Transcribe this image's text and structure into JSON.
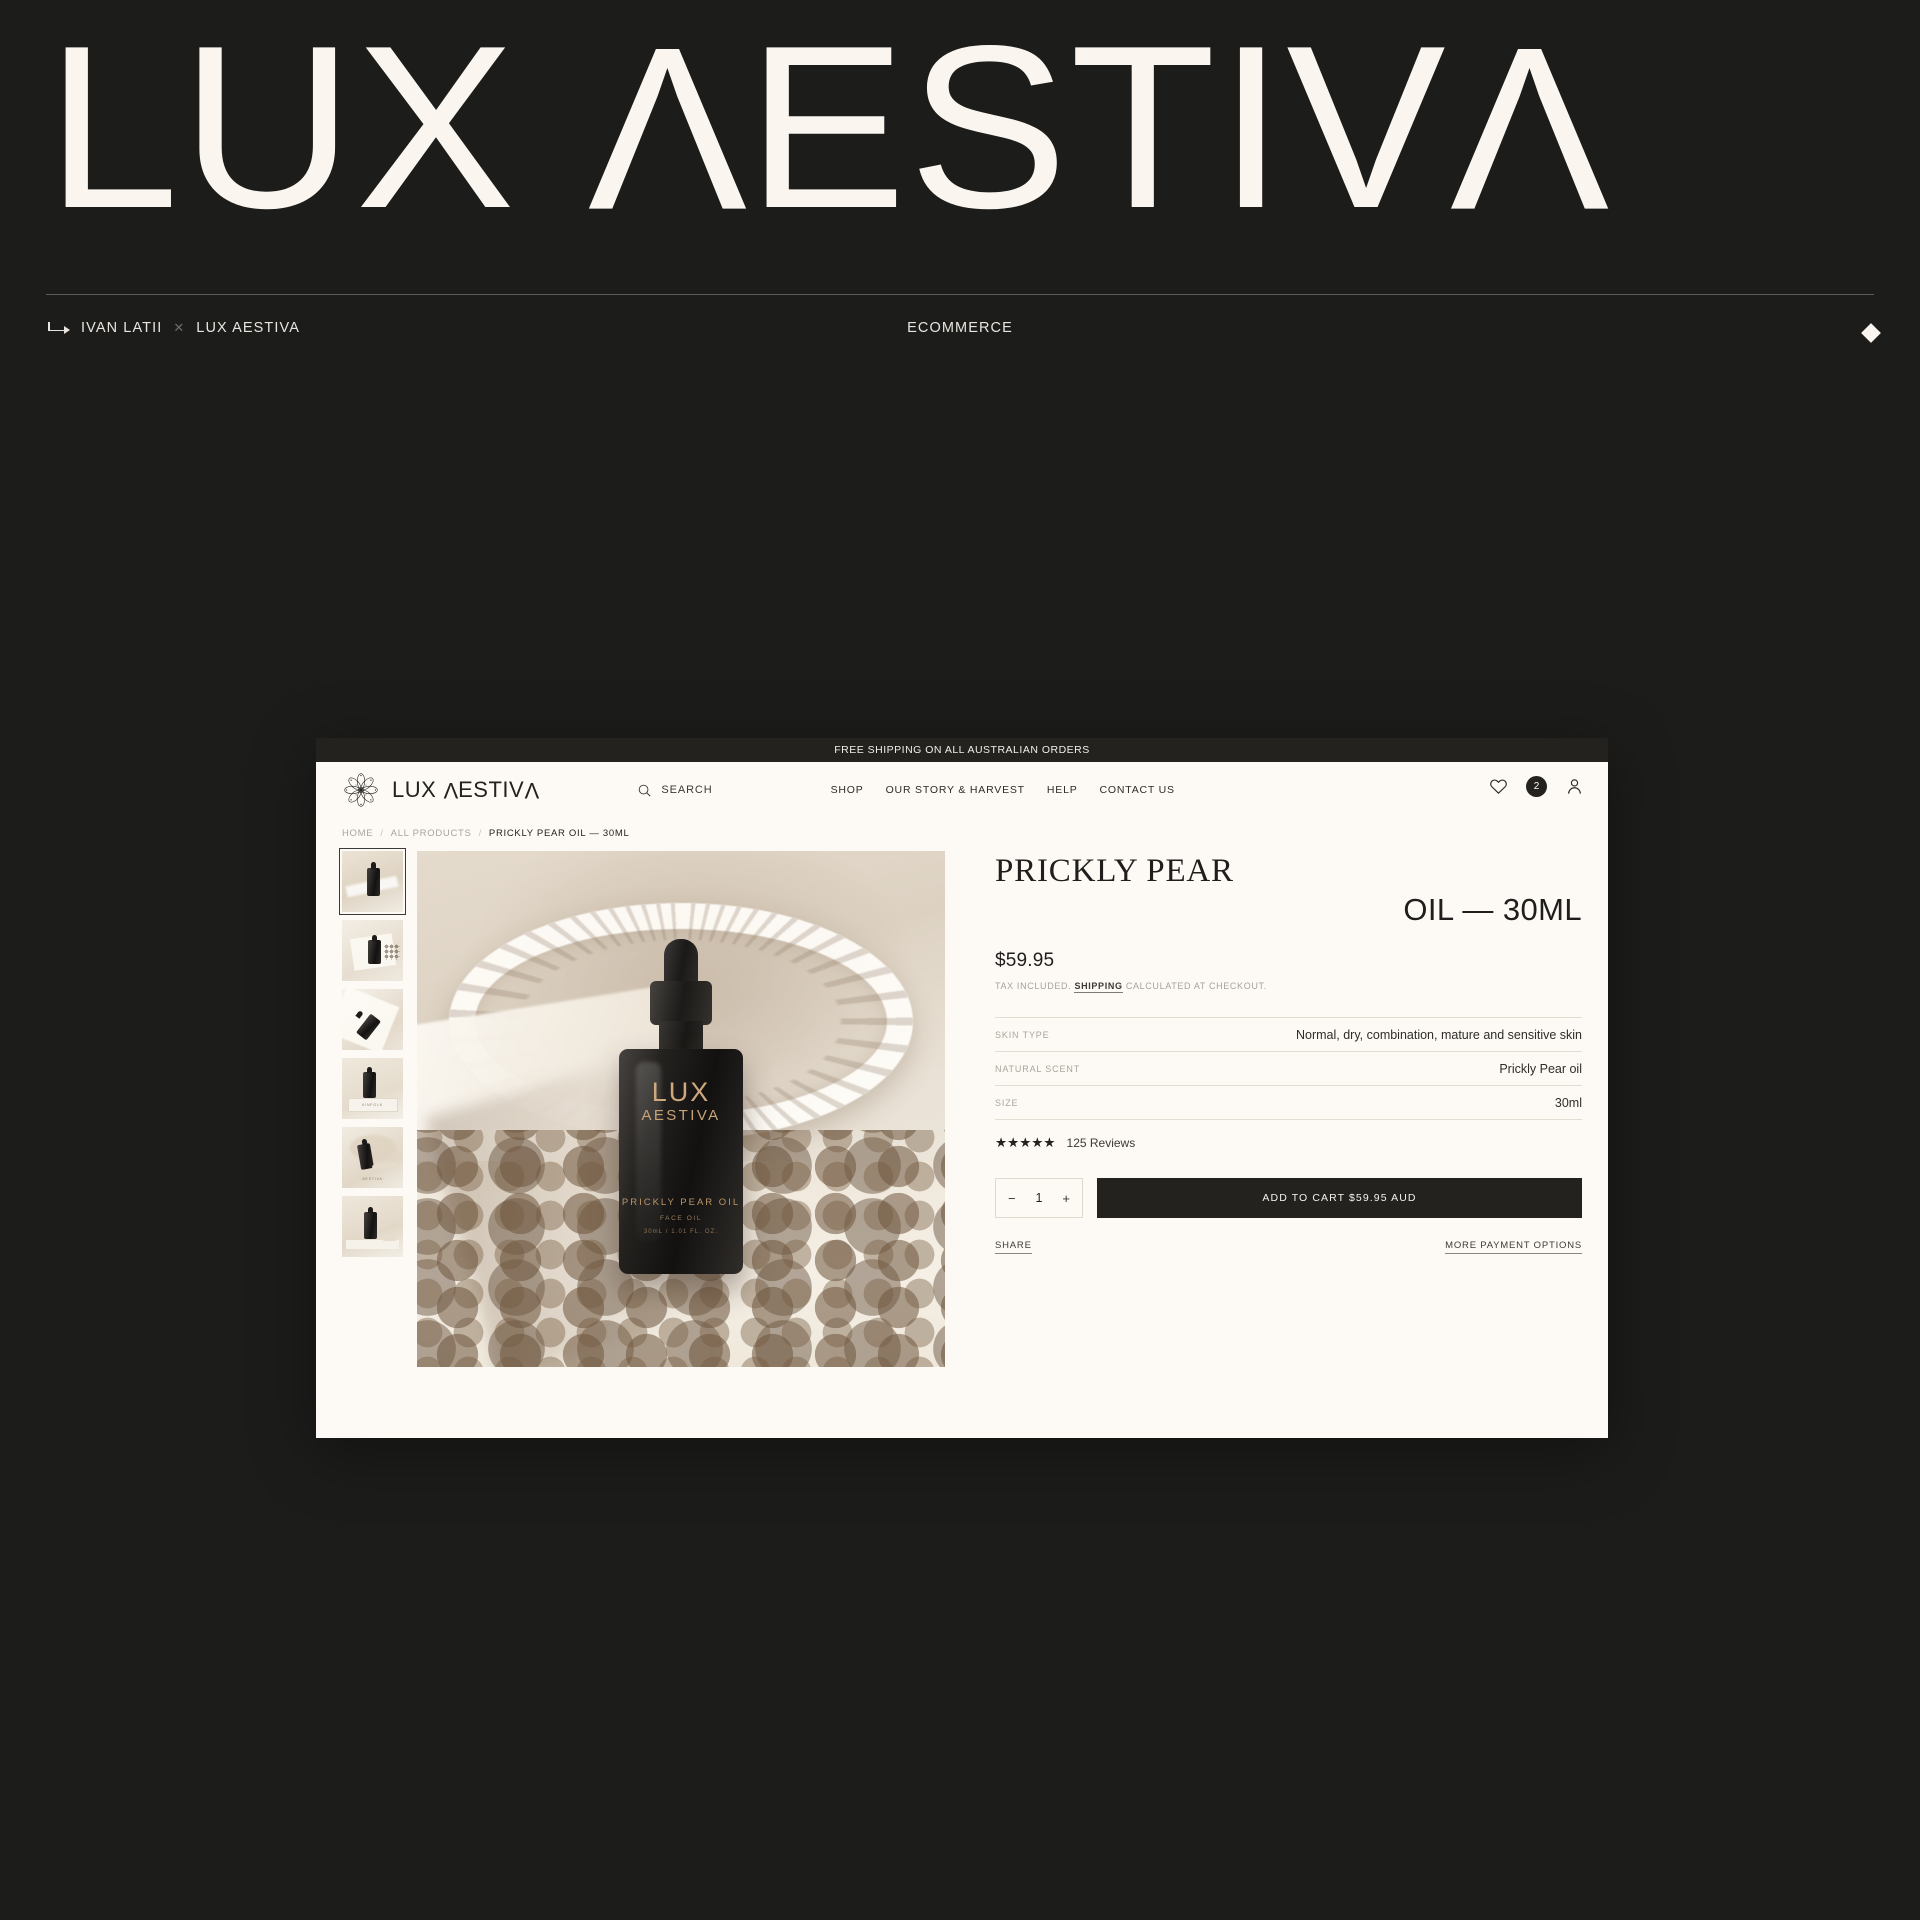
{
  "hero": {
    "title_part1": "LUX ",
    "title_part2": "ESTIV",
    "title_part3": ""
  },
  "meta": {
    "author": "IVAN LATII",
    "separator": "✕",
    "project": "LUX AESTIVA",
    "category": "ECOMMERCE",
    "marker_icon": "diamond-icon"
  },
  "site": {
    "announcement": "FREE SHIPPING ON ALL AUSTRALIAN ORDERS",
    "brand": {
      "logo_icon": "mandala-flower-icon",
      "word_1": "LUX ",
      "word_2": "ESTIV",
      "word_3": ""
    },
    "search": {
      "icon": "search-icon",
      "label": "SEARCH"
    },
    "nav": [
      {
        "label": "SHOP"
      },
      {
        "label": "OUR STORY & HARVEST"
      },
      {
        "label": "HELP"
      },
      {
        "label": "CONTACT US"
      }
    ],
    "actions": {
      "wishlist_icon": "heart-icon",
      "cart_icon": "cart-badge-icon",
      "cart_count": "2",
      "account_icon": "person-icon"
    }
  },
  "breadcrumb": {
    "items": [
      {
        "label": "HOME"
      },
      {
        "label": "ALL PRODUCTS"
      },
      {
        "label": "PRICKLY PEAR OIL — 30ML"
      }
    ],
    "separator": "/"
  },
  "gallery": {
    "selected_index": 0,
    "thumbs": [
      {
        "alt": "bottle on stone dish with cloth"
      },
      {
        "alt": "bottle with scattered botanicals"
      },
      {
        "alt": "bottle laid on draped linen"
      },
      {
        "alt": "bottle beside kinfolk magazine"
      },
      {
        "alt": "bottle with comb on linen"
      },
      {
        "alt": "bottle standing on stone ledge"
      }
    ],
    "main_image": {
      "bottle_label": {
        "brand_line1": "LUX",
        "brand_line2": "AESTIVA",
        "product": "PRICKLY PEAR OIL",
        "type": "FACE OIL",
        "volume": "30mL / 1.01 FL. OZ."
      }
    },
    "thumb_captions": {
      "kinfolk": "KINFOLK",
      "fourth": "AESTIVA"
    }
  },
  "product": {
    "title_serif": "PRICKLY PEAR",
    "title_sans": "OIL — 30ML",
    "price": "$59.95",
    "tax_prefix": "TAX INCLUDED.",
    "tax_link": "SHIPPING",
    "tax_suffix": "CALCULATED AT CHECKOUT.",
    "specs": [
      {
        "key": "SKIN TYPE",
        "value": "Normal, dry, combination, mature and sensitive skin"
      },
      {
        "key": "NATURAL SCENT",
        "value": "Prickly Pear oil"
      },
      {
        "key": "SIZE",
        "value": "30ml"
      }
    ],
    "rating": {
      "stars": "★★★★★",
      "star_count": 5,
      "count_label": "125 Reviews"
    },
    "quantity": {
      "decrement": "−",
      "value": "1",
      "increment": "+"
    },
    "add_to_cart": "ADD TO CART $59.95 AUD",
    "share_label": "SHARE",
    "more_payment_label": "MORE PAYMENT OPTIONS"
  },
  "colors": {
    "page_bg": "#1c1c1b",
    "cream": "#fdfaf5",
    "ink": "#23221f",
    "muted": "#a8a299"
  }
}
